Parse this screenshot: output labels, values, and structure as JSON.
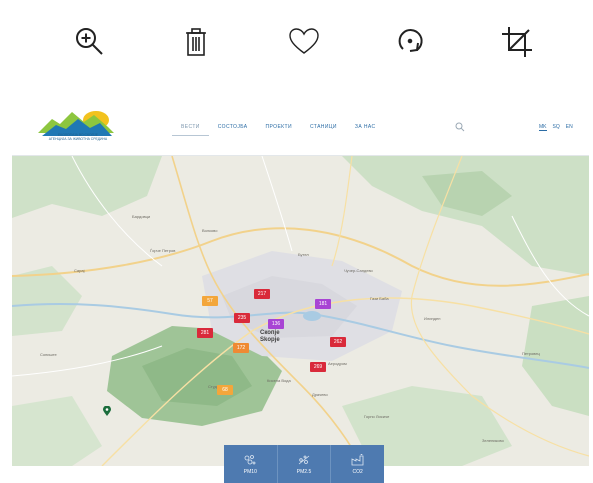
{
  "toolbar": {
    "icons": [
      "zoom-in-icon",
      "trash-icon",
      "heart-icon",
      "rotate-icon",
      "crop-icon"
    ]
  },
  "site": {
    "logo_lines": [
      "ЕКОЛОГИЈА ВО СКОПЈЕ",
      "АГЕНЦИЈА ЗА ЖИВОТНА СРЕДИНА"
    ],
    "nav": [
      "ВЕСТИ",
      "СОСТОЈБА",
      "ПРОЕКТИ",
      "СТАНИЦИ",
      "ЗА НАС"
    ],
    "langs": [
      "MK",
      "SQ",
      "EN"
    ]
  },
  "map": {
    "city_label_1": "Скопје",
    "city_label_2": "Skopje",
    "place_labels": [
      "Бардовци",
      "Волково",
      "Сарај",
      "Горно Лисиче",
      "Драчево",
      "Петровец",
      "Ѓорче Петров",
      "Бутел",
      "Чучер-Сандево",
      "Аеродром",
      "Кисела Вода",
      "Илинден",
      "Гази Баба",
      "Студеничани",
      "Зелениково",
      "Сопиште"
    ],
    "stations": [
      {
        "value": "217",
        "level": "very-high"
      },
      {
        "value": "57",
        "level": "moderate"
      },
      {
        "value": "235",
        "level": "very-high"
      },
      {
        "value": "136",
        "level": "extreme"
      },
      {
        "value": "181",
        "level": "extreme"
      },
      {
        "value": "281",
        "level": "very-high"
      },
      {
        "value": "172",
        "level": "high"
      },
      {
        "value": "262",
        "level": "very-high"
      },
      {
        "value": "269",
        "level": "very-high"
      },
      {
        "value": "68",
        "level": "moderate"
      }
    ],
    "colors": {
      "very-high": "#d92a3a",
      "high": "#ef8a34",
      "moderate": "#f3a63b",
      "extreme": "#a844d4"
    }
  },
  "tabs": [
    {
      "label": "PM10",
      "icon": "particles-icon"
    },
    {
      "label": "PM2.5",
      "icon": "fine-particles-icon"
    },
    {
      "label": "CO2",
      "icon": "factory-icon"
    }
  ]
}
